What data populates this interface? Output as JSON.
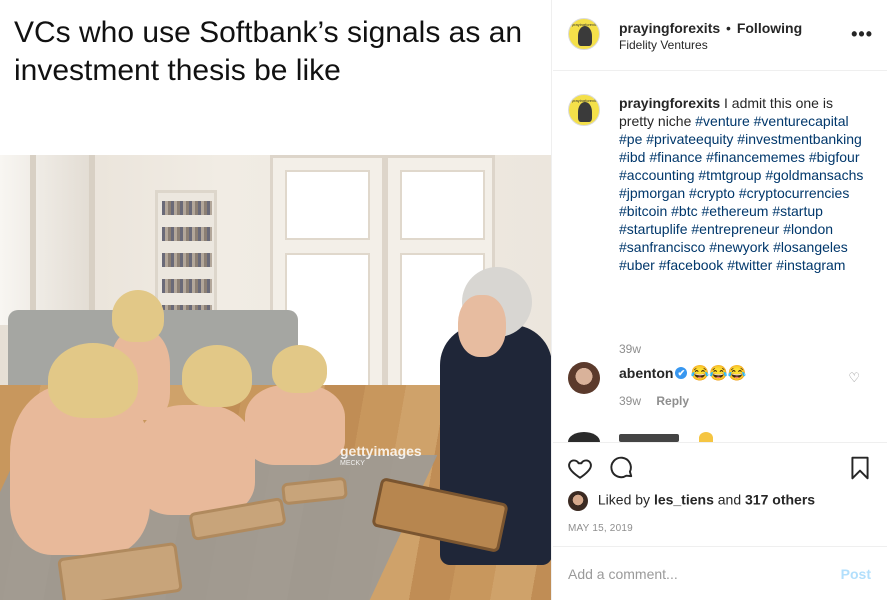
{
  "meme": {
    "caption": "VCs who use Softbank’s signals as an investment thesis be like",
    "watermark": "gettyimages",
    "watermark_credit": "MECKY"
  },
  "header": {
    "username": "prayingforexits",
    "separator": "•",
    "follow_status": "Following",
    "location": "Fidelity Ventures",
    "more_label": "•••",
    "avatar_text": "prayingforexits"
  },
  "caption": {
    "username": "prayingforexits",
    "text": "I admit this one is pretty niche",
    "hashtags": "#venture #venturecapital #pe #privateequity #investmentbanking #ibd #finance #financememes #bigfour #accounting #tmtgroup #goldmansachs #jpmorgan #crypto #cryptocurrencies #bitcoin #btc #ethereum #startup #startuplife #entrepreneur #london #sanfrancisco #newyork #losangeles #uber #facebook #twitter #instagram",
    "time": "39w"
  },
  "comment": {
    "username": "abenton",
    "verified": "✔",
    "text": "😂😂😂",
    "time": "39w",
    "reply_label": "Reply"
  },
  "actions": {
    "liked_by_prefix": "Liked by",
    "liked_by_user": "les_tiens",
    "and": "and",
    "others": "317 others",
    "date": "MAY 15, 2019"
  },
  "add_comment": {
    "placeholder": "Add a comment...",
    "post_label": "Post"
  },
  "colors": {
    "link": "#00376b",
    "verified": "#3897f0",
    "post_disabled": "#b2dffc",
    "muted": "#8e8e8e"
  }
}
